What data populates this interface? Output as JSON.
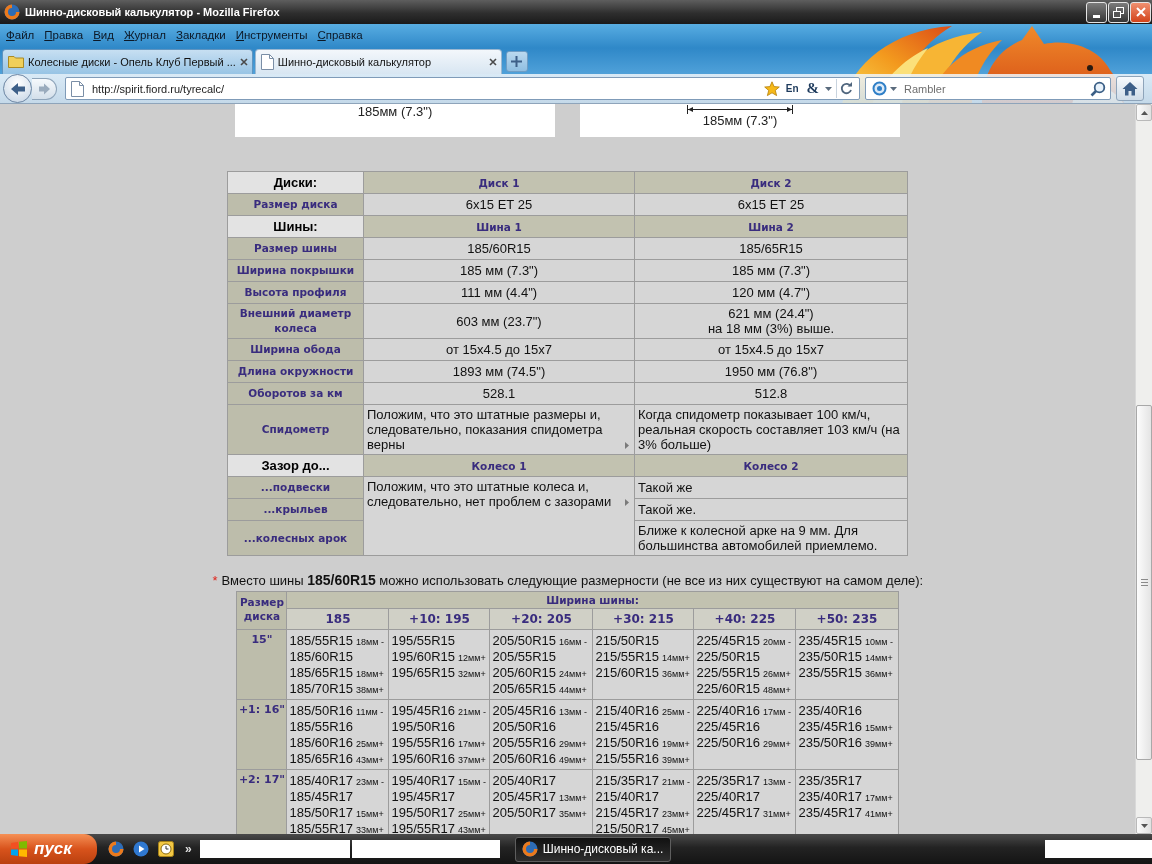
{
  "window": {
    "title": "Шинно-дисковый калькулятор - Mozilla Firefox"
  },
  "menu": [
    "Файл",
    "Правка",
    "Вид",
    "Журнал",
    "Закладки",
    "Инструменты",
    "Справка"
  ],
  "tabs": [
    {
      "title": "Колесные диски - Опель Клуб Первый ...",
      "selected": false
    },
    {
      "title": "Шинно-дисковый калькулятор",
      "selected": true
    }
  ],
  "nav": {
    "url": "http://spirit.fiord.ru/tyrecalc/",
    "addons": [
      "En",
      "&"
    ],
    "search_placeholder": "Rambler"
  },
  "diagrams": [
    {
      "kind": "label",
      "caption": "185мм (7.3\")"
    },
    {
      "kind": "dimension",
      "caption": "185мм (7.3\")"
    }
  ],
  "comparison": {
    "sections": [
      {
        "title": "Диски:",
        "kind": "grid",
        "columns": [
          "Диск 1",
          "Диск 2"
        ],
        "rows": [
          {
            "label": "Размер диска",
            "kind": "measure",
            "values": [
              {
                "text": "6x15 ET 25",
                "more": false
              },
              {
                "text": "6x15 ET 25",
                "more": false
              }
            ]
          }
        ]
      },
      {
        "title": "Шины:",
        "kind": "grid",
        "columns": [
          "Шина 1",
          "Шина 2"
        ],
        "rows": [
          {
            "label": "Размер шины",
            "kind": "measure",
            "values": [
              {
                "text": "185/60R15",
                "more": false
              },
              {
                "text": "185/65R15",
                "more": false
              }
            ]
          },
          {
            "label": "Ширина покрышки",
            "kind": "measure",
            "values": [
              {
                "text": "185 мм (7.3\")",
                "more": false
              },
              {
                "text": "185 мм (7.3\")",
                "more": false
              }
            ]
          },
          {
            "label": "Высота профиля",
            "kind": "measure",
            "values": [
              {
                "text": "111 мм (4.4\")",
                "more": false
              },
              {
                "text": "120 мм (4.7\")",
                "more": false
              }
            ]
          },
          {
            "label": "Внешний диаметр колеса",
            "kind": "measure",
            "values": [
              {
                "text": "603 мм (23.7\")",
                "more": false
              },
              {
                "text": "621 мм (24.4\")",
                "note": "на 18 мм (3%) выше.",
                "more": false
              }
            ]
          },
          {
            "label": "Ширина обода",
            "kind": "measure",
            "values": [
              {
                "text": "от 15x4.5 до 15x7",
                "more": false
              },
              {
                "text": "от 15x4.5 до 15x7",
                "more": false
              }
            ]
          },
          {
            "label": "Длина окружности",
            "kind": "measure",
            "values": [
              {
                "text": "1893 мм (74.5\")",
                "more": false
              },
              {
                "text": "1950 мм (76.8\")",
                "more": false
              }
            ]
          },
          {
            "label": "Оборотов за км",
            "kind": "measure",
            "values": [
              {
                "text": "528.1",
                "more": false
              },
              {
                "text": "512.8",
                "more": false
              }
            ]
          },
          {
            "label": "Спидометр",
            "kind": "remark",
            "values": [
              {
                "text": "Положим, что это штатные размеры и, следовательно, показания спидометра верны",
                "more": true
              },
              {
                "text": "Когда спидометр показывает 100 км/ч, реальная скорость составляет 103 км/ч (на 3% больше)",
                "more": false
              }
            ]
          }
        ]
      },
      {
        "title": "Зазор до...",
        "kind": "shared",
        "columns": [
          "Колесо 1",
          "Колесо 2"
        ],
        "shared": {
          "text": "Положим, что это штатные колеса и, следовательно, нет проблем с зазорами",
          "more": true
        },
        "rows": [
          {
            "label": "...подвески",
            "kind": "remark",
            "values": [
              {
                "text": "Такой же",
                "more": false
              }
            ]
          },
          {
            "label": "...крыльев",
            "kind": "remark",
            "values": [
              {
                "text": "Такой же.",
                "more": false
              }
            ]
          },
          {
            "label": "...колесных арок",
            "kind": "remark",
            "values": [
              {
                "text": "Ближе к колесной арке на 9 мм. Для большинства автомобилей приемлемо.",
                "more": false
              }
            ]
          }
        ]
      }
    ]
  },
  "footnote": {
    "marker": "*",
    "text": "Вместо шины **185/60R15** можно использовать следующие размерности (не все из них существуют на самом деле):"
  },
  "alternatives": {
    "corner": "Размер диска",
    "group_header": "Ширина шины:",
    "columns": [
      "185",
      "+10: 195",
      "+20: 205",
      "+30: 215",
      "+40: 225",
      "+50: 235"
    ],
    "rows": [
      {
        "rim": "15\"",
        "cells": [
          [
            {
              "size": "185/55R15",
              "diff": "18мм -"
            },
            {
              "size": "185/60R15"
            },
            {
              "size": "185/65R15",
              "diff": "18мм+"
            },
            {
              "size": "185/70R15",
              "diff": "38мм+"
            }
          ],
          [
            {
              "size": "195/55R15"
            },
            {
              "size": "195/60R15",
              "diff": "12мм+"
            },
            {
              "size": "195/65R15",
              "diff": "32мм+"
            }
          ],
          [
            {
              "size": "205/50R15",
              "diff": "16мм -"
            },
            {
              "size": "205/55R15"
            },
            {
              "size": "205/60R15",
              "diff": "24мм+"
            },
            {
              "size": "205/65R15",
              "diff": "44мм+"
            }
          ],
          [
            {
              "size": "215/50R15"
            },
            {
              "size": "215/55R15",
              "diff": "14мм+"
            },
            {
              "size": "215/60R15",
              "diff": "36мм+"
            }
          ],
          [
            {
              "size": "225/45R15",
              "diff": "20мм -"
            },
            {
              "size": "225/50R15"
            },
            {
              "size": "225/55R15",
              "diff": "26мм+"
            },
            {
              "size": "225/60R15",
              "diff": "48мм+"
            }
          ],
          [
            {
              "size": "235/45R15",
              "diff": "10мм -"
            },
            {
              "size": "235/50R15",
              "diff": "14мм+"
            },
            {
              "size": "235/55R15",
              "diff": "36мм+"
            }
          ]
        ]
      },
      {
        "rim": "+1: 16\"",
        "cells": [
          [
            {
              "size": "185/50R16",
              "diff": "11мм -"
            },
            {
              "size": "185/55R16"
            },
            {
              "size": "185/60R16",
              "diff": "25мм+"
            },
            {
              "size": "185/65R16",
              "diff": "43мм+"
            }
          ],
          [
            {
              "size": "195/45R16",
              "diff": "21мм -"
            },
            {
              "size": "195/50R16"
            },
            {
              "size": "195/55R16",
              "diff": "17мм+"
            },
            {
              "size": "195/60R16",
              "diff": "37мм+"
            }
          ],
          [
            {
              "size": "205/45R16",
              "diff": "13мм -"
            },
            {
              "size": "205/50R16"
            },
            {
              "size": "205/55R16",
              "diff": "29мм+"
            },
            {
              "size": "205/60R16",
              "diff": "49мм+"
            }
          ],
          [
            {
              "size": "215/40R16",
              "diff": "25мм -"
            },
            {
              "size": "215/45R16"
            },
            {
              "size": "215/50R16",
              "diff": "19мм+"
            },
            {
              "size": "215/55R16",
              "diff": "39мм+"
            }
          ],
          [
            {
              "size": "225/40R16",
              "diff": "17мм -"
            },
            {
              "size": "225/45R16"
            },
            {
              "size": "225/50R16",
              "diff": "29мм+"
            }
          ],
          [
            {
              "size": "235/40R16"
            },
            {
              "size": "235/45R16",
              "diff": "15мм+"
            },
            {
              "size": "235/50R16",
              "diff": "39мм+"
            }
          ]
        ]
      },
      {
        "rim": "+2: 17\"",
        "cells": [
          [
            {
              "size": "185/40R17",
              "diff": "23мм -"
            },
            {
              "size": "185/45R17"
            },
            {
              "size": "185/50R17",
              "diff": "15мм+"
            },
            {
              "size": "185/55R17",
              "diff": "33мм+"
            }
          ],
          [
            {
              "size": "195/40R17",
              "diff": "15мм -"
            },
            {
              "size": "195/45R17"
            },
            {
              "size": "195/50R17",
              "diff": "25мм+"
            },
            {
              "size": "195/55R17",
              "diff": "43мм+"
            }
          ],
          [
            {
              "size": "205/40R17"
            },
            {
              "size": "205/45R17",
              "diff": "13мм+"
            },
            {
              "size": "205/50R17",
              "diff": "35мм+"
            }
          ],
          [
            {
              "size": "215/35R17",
              "diff": "21мм -"
            },
            {
              "size": "215/40R17"
            },
            {
              "size": "215/45R17",
              "diff": "23мм+"
            },
            {
              "size": "215/50R17",
              "diff": "45мм+"
            }
          ],
          [
            {
              "size": "225/35R17",
              "diff": "13мм -"
            },
            {
              "size": "225/40R17"
            },
            {
              "size": "225/45R17",
              "diff": "31мм+"
            }
          ],
          [
            {
              "size": "235/35R17"
            },
            {
              "size": "235/40R17",
              "diff": "17мм+"
            },
            {
              "size": "235/45R17",
              "diff": "41мм+"
            }
          ]
        ]
      }
    ]
  },
  "taskbar": {
    "start": "пуск",
    "overflow": "»",
    "tasks": [
      {
        "label": "Шинно-дисковый ка...",
        "selected": true
      }
    ]
  }
}
